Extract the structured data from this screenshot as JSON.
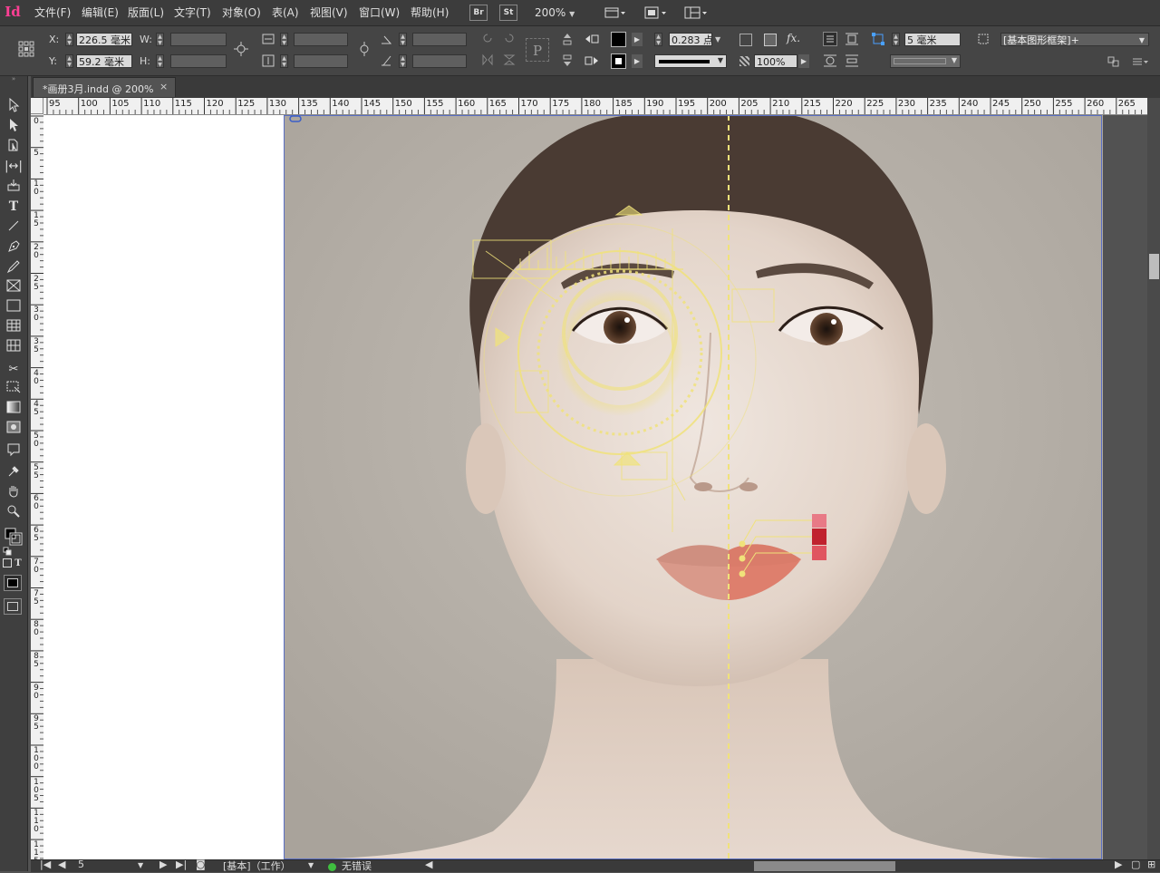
{
  "app": {
    "logo": "Id",
    "accent": "#ff3f94"
  },
  "menu": [
    {
      "label": "文件(F)"
    },
    {
      "label": "编辑(E)"
    },
    {
      "label": "版面(L)"
    },
    {
      "label": "文字(T)"
    },
    {
      "label": "对象(O)"
    },
    {
      "label": "表(A)"
    },
    {
      "label": "视图(V)"
    },
    {
      "label": "窗口(W)"
    },
    {
      "label": "帮助(H)"
    }
  ],
  "appbar": {
    "bridge": "Br",
    "stock": "St",
    "zoom": "200%"
  },
  "control": {
    "x_label": "X:",
    "x_value": "226.5 毫米",
    "y_label": "Y:",
    "y_value": "59.2 毫米",
    "w_label": "W:",
    "h_label": "H:",
    "stroke_weight": "0.283 点",
    "opacity": "100%",
    "corner_size": "5 毫米",
    "object_style": "[基本图形框架]+",
    "fx": "fx."
  },
  "document": {
    "tab_title": "*画册3月.indd @ 200%",
    "close": "×"
  },
  "ruler": {
    "h_labels": [
      "95",
      "100",
      "105",
      "110",
      "115",
      "120",
      "125",
      "130",
      "135",
      "140",
      "145",
      "150",
      "155",
      "160",
      "165",
      "170",
      "175",
      "180",
      "185",
      "190",
      "195",
      "200",
      "205",
      "210",
      "215",
      "220",
      "225",
      "230",
      "235",
      "240",
      "245",
      "250",
      "255",
      "260",
      "265"
    ],
    "v_labels": [
      "0",
      "5",
      "10",
      "15",
      "20",
      "25",
      "30",
      "35",
      "40",
      "45",
      "50",
      "55",
      "60",
      "65",
      "70",
      "75",
      "80",
      "85",
      "90",
      "95",
      "100",
      "105",
      "110",
      "115"
    ]
  },
  "status": {
    "page": "5",
    "preflight_profile": "[基本]（工作）",
    "preflight_status": "无错误",
    "status_color": "#3fbf3f"
  },
  "swatches": [
    "#e87a86",
    "#c0222e",
    "#e05560"
  ],
  "overlay_color": "#f0e27a"
}
